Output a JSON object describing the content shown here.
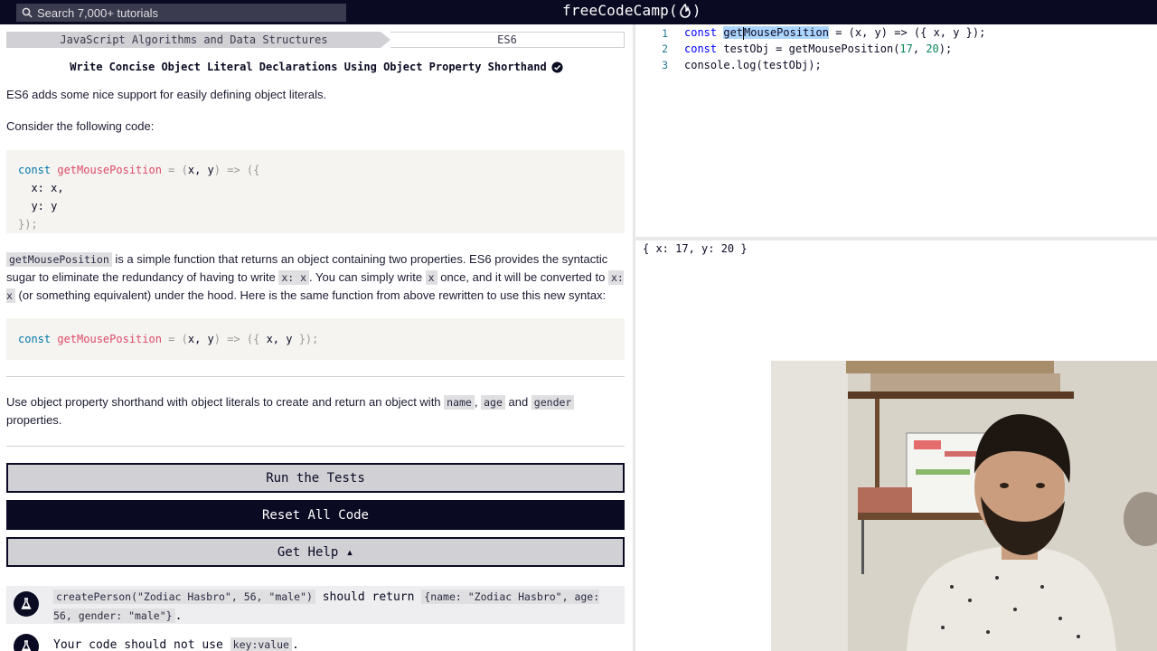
{
  "topnav": {
    "search_placeholder": "Search 7,000+ tutorials",
    "brand_left": "freeCodeCamp(",
    "brand_right": ")"
  },
  "breadcrumb": {
    "section": "JavaScript Algorithms and Data Structures",
    "subsection": "ES6"
  },
  "challenge": {
    "title": "Write Concise Object Literal Declarations Using Object Property Shorthand",
    "p1": "ES6 adds some nice support for easily defining object literals.",
    "p2": "Consider the following code:",
    "code1": {
      "kw": "const",
      "fn": "getMousePosition",
      "rest1a": " = ",
      "rest1b": "(",
      "args": "x, y",
      "rest1c": ") => ({",
      "l2a": "  x: ",
      "l2b": "x,",
      "l3": "  y: y",
      "l4": "});"
    },
    "p3": {
      "c1": "getMousePosition",
      "t1": " is a simple function that returns an object containing two properties. ES6 provides the syntactic sugar to eliminate the redundancy of having to write ",
      "c2": "x: x",
      "t2": ". You can simply write ",
      "c3": "x",
      "t3": " once, and it will be converted to ",
      "c4": "x: x",
      "t4": " (or something equivalent) under the hood. Here is the same function from above rewritten to use this new syntax:"
    },
    "code2": {
      "kw": "const",
      "fn": "getMousePosition",
      "a": " = (",
      "args": "x, y",
      "b": ") => ({ ",
      "c": "x, y",
      "d": " });"
    },
    "p4": {
      "t1": "Use object property shorthand with object literals to create and return an object with ",
      "c1": "name",
      "t2": ", ",
      "c2": "age",
      "t3": " and ",
      "c3": "gender",
      "t4": " properties."
    }
  },
  "buttons": {
    "run": "Run the Tests",
    "reset": "Reset All Code",
    "help": "Get Help ▴"
  },
  "tests": [
    {
      "c1": "createPerson(\"Zodiac Hasbro\", 56, \"male\")",
      "t1": " should return ",
      "c2": "{name: \"Zodiac Hasbro\", age: 56, gender: \"male\"}",
      "t2": "."
    },
    {
      "t1": "Your code should not use ",
      "c1": "key:value",
      "t2": "."
    }
  ],
  "editor": {
    "lines": [
      {
        "num": "1",
        "kw": "const",
        "sel_a": "get",
        "sel_b": "MousePosition",
        "rest": " = (x, y) => ({ x, y });"
      },
      {
        "num": "2",
        "kw": "const",
        "a": " testObj = getMousePosition(",
        "n1": "17",
        "b": ", ",
        "n2": "20",
        "c": ");"
      },
      {
        "num": "3",
        "text": "console.log(testObj);"
      }
    ]
  },
  "console": {
    "output": "{ x: 17, y: 20 }"
  },
  "colors": {
    "nav": "#0a0a23",
    "accent": "#0a0a23",
    "code_bg": "#f5f4f0"
  }
}
